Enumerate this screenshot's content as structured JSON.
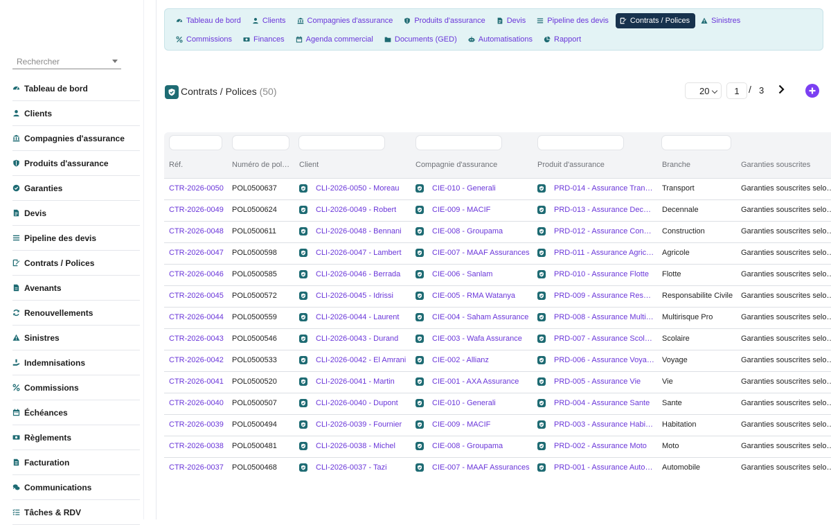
{
  "sidebar": {
    "search_placeholder": "Rechercher",
    "items": [
      {
        "label": "Tableau de bord",
        "icon": "dashboard-icon"
      },
      {
        "label": "Clients",
        "icon": "user-icon"
      },
      {
        "label": "Compagnies d'assurance",
        "icon": "bank-icon"
      },
      {
        "label": "Produits d'assurance",
        "icon": "shield-icon"
      },
      {
        "label": "Garanties",
        "icon": "check-badge-icon"
      },
      {
        "label": "Devis",
        "icon": "document-icon"
      },
      {
        "label": "Pipeline des devis",
        "icon": "list-icon"
      },
      {
        "label": "Contrats / Polices",
        "icon": "signature-icon"
      },
      {
        "label": "Avenants",
        "icon": "file-icon"
      },
      {
        "label": "Renouvellements",
        "icon": "refresh-icon"
      },
      {
        "label": "Sinistres",
        "icon": "warning-icon"
      },
      {
        "label": "Indemnisations",
        "icon": "hand-money-icon"
      },
      {
        "label": "Commissions",
        "icon": "percent-icon"
      },
      {
        "label": "Échéances",
        "icon": "calendar-icon"
      },
      {
        "label": "Règlements",
        "icon": "money-icon"
      },
      {
        "label": "Facturation",
        "icon": "invoice-icon"
      },
      {
        "label": "Communications",
        "icon": "chat-icon"
      },
      {
        "label": "Tâches & RDV",
        "icon": "tasks-icon"
      }
    ]
  },
  "topmenu": {
    "row1": [
      {
        "label": "Tableau de bord",
        "icon": "dashboard-icon",
        "active": false
      },
      {
        "label": "Clients",
        "icon": "user-icon",
        "active": false
      },
      {
        "label": "Compagnies d'assurance",
        "icon": "bank-icon",
        "active": false
      },
      {
        "label": "Produits d'assurance",
        "icon": "shield-icon",
        "active": false
      },
      {
        "label": "Devis",
        "icon": "document-icon",
        "active": false
      },
      {
        "label": "Pipeline des devis",
        "icon": "list-icon",
        "active": false
      },
      {
        "label": "Contrats / Polices",
        "icon": "signature-icon",
        "active": true
      },
      {
        "label": "Sinistres",
        "icon": "warning-icon",
        "active": false
      }
    ],
    "row2": [
      {
        "label": "Commissions",
        "icon": "percent-icon",
        "active": false
      },
      {
        "label": "Finances",
        "icon": "money-icon",
        "active": false
      },
      {
        "label": "Agenda commercial",
        "icon": "calendar-icon",
        "active": false
      },
      {
        "label": "Documents (GED)",
        "icon": "folder-icon",
        "active": false
      },
      {
        "label": "Automatisations",
        "icon": "robot-icon",
        "active": false
      },
      {
        "label": "Rapport",
        "icon": "chart-pie-icon",
        "active": false
      }
    ]
  },
  "page": {
    "title": "Contrats / Polices",
    "count": "(50)"
  },
  "pager": {
    "page_size": "20",
    "current_page": "1",
    "slash": "/",
    "total_pages": "3"
  },
  "table": {
    "columns": [
      "Réf.",
      "Numéro de pol…",
      "Client",
      "Compagnie d'assurance",
      "Produit d'assurance",
      "Branche",
      "Garanties souscrites"
    ],
    "rows": [
      {
        "ref": "CTR-2026-0050",
        "num": "POL0500637",
        "client": "CLI-2026-0050 - Moreau",
        "cie": "CIE-010 - Generali",
        "prod": "PRD-014 - Assurance Tran…",
        "branche": "Transport",
        "garanties": "Garanties souscrites selon…"
      },
      {
        "ref": "CTR-2026-0049",
        "num": "POL0500624",
        "client": "CLI-2026-0049 - Robert",
        "cie": "CIE-009 - MACIF",
        "prod": "PRD-013 - Assurance Dec…",
        "branche": "Decennale",
        "garanties": "Garanties souscrites selon…"
      },
      {
        "ref": "CTR-2026-0048",
        "num": "POL0500611",
        "client": "CLI-2026-0048 - Bennani",
        "cie": "CIE-008 - Groupama",
        "prod": "PRD-012 - Assurance Con…",
        "branche": "Construction",
        "garanties": "Garanties souscrites selon…"
      },
      {
        "ref": "CTR-2026-0047",
        "num": "POL0500598",
        "client": "CLI-2026-0047 - Lambert",
        "cie": "CIE-007 - MAAF Assurances",
        "prod": "PRD-011 - Assurance Agric…",
        "branche": "Agricole",
        "garanties": "Garanties souscrites selon…"
      },
      {
        "ref": "CTR-2026-0046",
        "num": "POL0500585",
        "client": "CLI-2026-0046 - Berrada",
        "cie": "CIE-006 - Sanlam",
        "prod": "PRD-010 - Assurance Flotte",
        "branche": "Flotte",
        "garanties": "Garanties souscrites selon…"
      },
      {
        "ref": "CTR-2026-0045",
        "num": "POL0500572",
        "client": "CLI-2026-0045 - Idrissi",
        "cie": "CIE-005 - RMA Watanya",
        "prod": "PRD-009 - Assurance Res…",
        "branche": "Responsabilite Civile",
        "garanties": "Garanties souscrites selon…"
      },
      {
        "ref": "CTR-2026-0044",
        "num": "POL0500559",
        "client": "CLI-2026-0044 - Laurent",
        "cie": "CIE-004 - Saham Assurance",
        "prod": "PRD-008 - Assurance Multi…",
        "branche": "Multirisque Pro",
        "garanties": "Garanties souscrites selon…"
      },
      {
        "ref": "CTR-2026-0043",
        "num": "POL0500546",
        "client": "CLI-2026-0043 - Durand",
        "cie": "CIE-003 - Wafa Assurance",
        "prod": "PRD-007 - Assurance Scol…",
        "branche": "Scolaire",
        "garanties": "Garanties souscrites selon…"
      },
      {
        "ref": "CTR-2026-0042",
        "num": "POL0500533",
        "client": "CLI-2026-0042 - El Amrani",
        "cie": "CIE-002 - Allianz",
        "prod": "PRD-006 - Assurance Voya…",
        "branche": "Voyage",
        "garanties": "Garanties souscrites selon…"
      },
      {
        "ref": "CTR-2026-0041",
        "num": "POL0500520",
        "client": "CLI-2026-0041 - Martin",
        "cie": "CIE-001 - AXA Assurance",
        "prod": "PRD-005 - Assurance Vie",
        "branche": "Vie",
        "garanties": "Garanties souscrites selon…"
      },
      {
        "ref": "CTR-2026-0040",
        "num": "POL0500507",
        "client": "CLI-2026-0040 - Dupont",
        "cie": "CIE-010 - Generali",
        "prod": "PRD-004 - Assurance Sante",
        "branche": "Sante",
        "garanties": "Garanties souscrites selon…"
      },
      {
        "ref": "CTR-2026-0039",
        "num": "POL0500494",
        "client": "CLI-2026-0039 - Fournier",
        "cie": "CIE-009 - MACIF",
        "prod": "PRD-003 - Assurance Habi…",
        "branche": "Habitation",
        "garanties": "Garanties souscrites selon…"
      },
      {
        "ref": "CTR-2026-0038",
        "num": "POL0500481",
        "client": "CLI-2026-0038 - Michel",
        "cie": "CIE-008 - Groupama",
        "prod": "PRD-002 - Assurance Moto",
        "branche": "Moto",
        "garanties": "Garanties souscrites selon…"
      },
      {
        "ref": "CTR-2026-0037",
        "num": "POL0500468",
        "client": "CLI-2026-0037 - Tazi",
        "cie": "CIE-007 - MAAF Assurances",
        "prod": "PRD-001 - Assurance Auto…",
        "branche": "Automobile",
        "garanties": "Garanties souscrites selon…"
      }
    ]
  },
  "colors": {
    "accent": "#6a36d9",
    "teal": "#1e6b73",
    "active_bg": "#17324d",
    "menu_bg": "#e3f3f5",
    "add_button": "#7b3ff2"
  }
}
